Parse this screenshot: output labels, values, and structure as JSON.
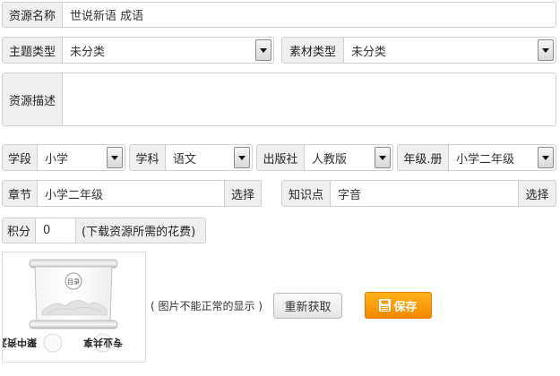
{
  "resource_name": {
    "label": "资源名称",
    "value": "世说新语 成语"
  },
  "topic_type": {
    "label": "主题类型",
    "selected": "未分类"
  },
  "material_type": {
    "label": "素材类型",
    "selected": "未分类"
  },
  "description": {
    "label": "资源描述",
    "value": ""
  },
  "stage": {
    "label": "学段",
    "selected": "小学"
  },
  "subject": {
    "label": "学科",
    "selected": "语文"
  },
  "publisher": {
    "label": "出版社",
    "selected": "人教版"
  },
  "grade": {
    "label": "年级.册",
    "selected": "小学二年级"
  },
  "chapter": {
    "label": "章节",
    "value": "小学二年级",
    "pick_label": "选择"
  },
  "knowledge": {
    "label": "知识点",
    "value": "字音",
    "pick_label": "选择"
  },
  "points": {
    "label": "积分",
    "value": "0",
    "note": "(下载资源所需的花费)"
  },
  "thumbnail": {
    "notice": "( 图片不能正常的显示 )",
    "refresh_label": "重新获取",
    "save_label": "保存",
    "caption_left": "聚中资源",
    "caption_right": "专业共享",
    "scroll_badge": "目录"
  }
}
